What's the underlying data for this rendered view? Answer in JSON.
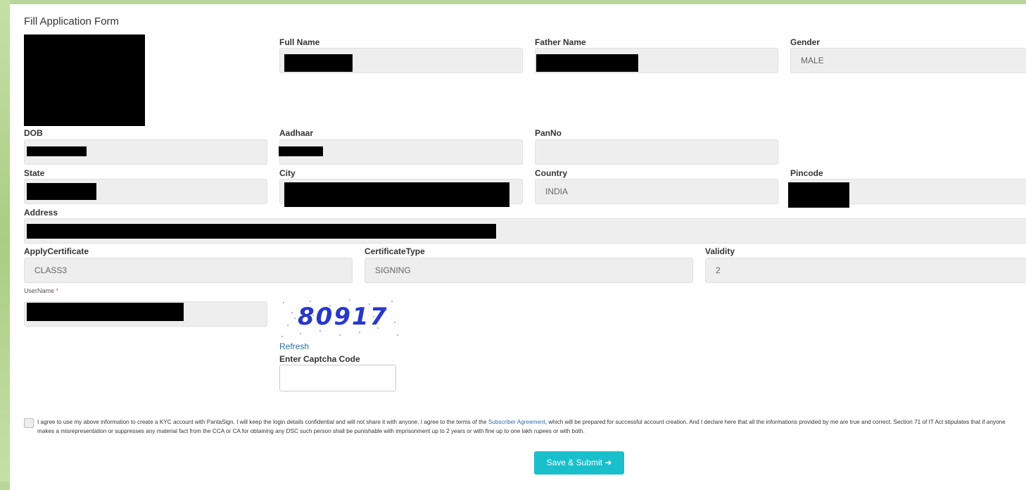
{
  "form": {
    "title": "Fill Application Form",
    "labels": {
      "full_name": "Full Name",
      "father_name": "Father Name",
      "gender": "Gender",
      "dob": "DOB",
      "aadhaar": "Aadhaar",
      "panno": "PanNo",
      "state": "State",
      "city": "City",
      "country": "Country",
      "pincode": "Pincode",
      "address": "Address",
      "apply_certificate": "ApplyCertificate",
      "certificate_type": "CertificateType",
      "validity": "Validity",
      "username": "UserName",
      "required_mark": "*",
      "enter_captcha": "Enter Captcha Code"
    },
    "values": {
      "gender": "MALE",
      "country": "INDIA",
      "apply_certificate": "CLASS3",
      "certificate_type": "SIGNING",
      "validity": "2",
      "captcha_input": ""
    },
    "captcha": {
      "code": "80917",
      "refresh_label": "Refresh"
    },
    "agreement": {
      "text_before_link": "I agree to use my above information to create a KYC account with PantaSign. I will keep the login details confidential and will not share it with anyone. I agree to the terms of the ",
      "link_text": "Subscriber Agreement",
      "text_after_link": ", which will be prepared for successful account creation. And I declare here that all the informations provided by me are true and correct. Section 71 of IT Act stipulates that if anyone makes a misrepresentation or suppresses any material fact from the CCA or CA for obtaining any DSC such person shall be punishable with imprisonment up to 2 years or with fine up to one lakh rupees or with both.",
      "checked": false
    },
    "submit_label": "Save & Submit",
    "submit_icon": "arrow-right-icon"
  },
  "colors": {
    "accent": "#19bfcb",
    "link": "#2a6db3",
    "field_bg": "#eeeeef",
    "page_bg": "#b9d79a"
  }
}
